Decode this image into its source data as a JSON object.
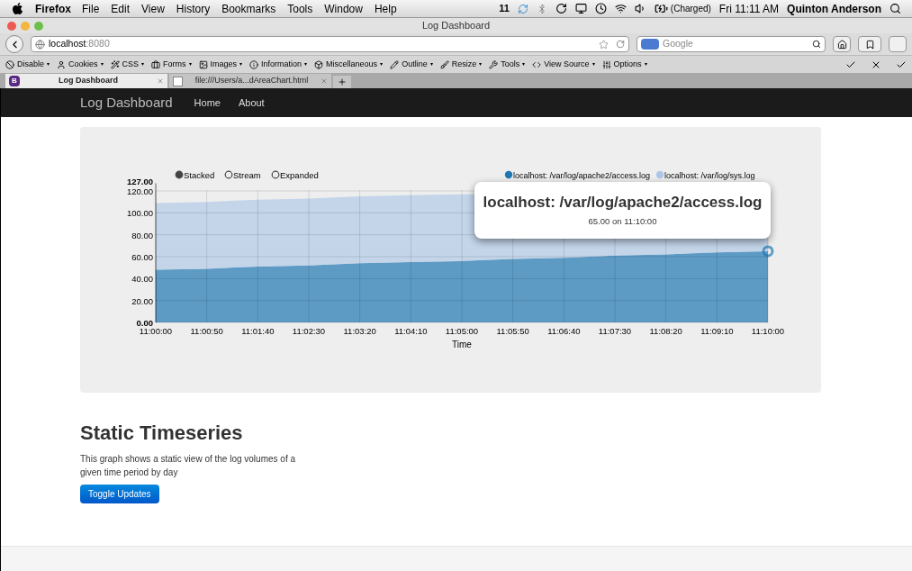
{
  "menu_bar": {
    "app": "Firefox",
    "items": [
      "File",
      "Edit",
      "View",
      "History",
      "Bookmarks",
      "Tools",
      "Window",
      "Help"
    ],
    "status": {
      "adobe_count": "11",
      "battery": "(Charged)",
      "clock": "Fri 11:11 AM",
      "user": "Quinton Anderson"
    }
  },
  "window": {
    "title": "Log Dashboard"
  },
  "address_bar": {
    "host": "localhost",
    "port": ":8080",
    "search_placeholder": "Google"
  },
  "dev_toolbar": [
    {
      "label": "Disable",
      "caret": "▾"
    },
    {
      "label": "Cookies",
      "caret": "▾"
    },
    {
      "label": "CSS",
      "caret": "▾"
    },
    {
      "label": "Forms",
      "caret": "▾"
    },
    {
      "label": "Images",
      "caret": "▾"
    },
    {
      "label": "Information",
      "caret": "▾"
    },
    {
      "label": "Miscellaneous",
      "caret": "▾"
    },
    {
      "label": "Outline",
      "caret": "▾"
    },
    {
      "label": "Resize",
      "caret": "▾"
    },
    {
      "label": "Tools",
      "caret": "▾"
    },
    {
      "label": "View Source",
      "caret": "▾"
    },
    {
      "label": "Options",
      "caret": "▾"
    }
  ],
  "tabs": [
    {
      "label": "Log Dashboard",
      "favicon": "B",
      "selected": true
    },
    {
      "label": "file:///Users/a...dAreaChart.html",
      "selected": false
    }
  ],
  "navbar": {
    "brand": "Log Dashboard",
    "links": [
      "Home",
      "About"
    ]
  },
  "chart": {
    "modes": [
      {
        "label": "Stacked",
        "selected": true
      },
      {
        "label": "Stream",
        "selected": false
      },
      {
        "label": "Expanded",
        "selected": false
      }
    ],
    "tooltip": {
      "title": "localhost: /var/log/apache2/access.log",
      "text": "65.00 on 11:10:00"
    },
    "chart_data": {
      "type": "area",
      "stacked": true,
      "grid": true,
      "legend": "top-right",
      "xlabel": "Time",
      "categories": [
        "11:00:00",
        "11:00:50",
        "11:01:40",
        "11:02:30",
        "11:03:20",
        "11:04:10",
        "11:05:00",
        "11:05:50",
        "11:06:40",
        "11:07:30",
        "11:08:20",
        "11:09:10",
        "11:10:00"
      ],
      "series": [
        {
          "name": "localhost: /var/log/apache2/access.log",
          "color": "#1f77b4",
          "values": [
            48,
            49,
            51,
            52,
            54,
            55,
            56,
            58,
            59,
            61,
            62,
            64,
            65
          ]
        },
        {
          "name": "localhost: /var/log/sys.log",
          "color": "#aec7e8",
          "values": [
            61,
            61,
            61,
            61,
            61,
            61,
            61,
            null,
            null,
            null,
            null,
            null,
            null
          ]
        }
      ],
      "yticks": [
        {
          "value": 0,
          "label": "0.00"
        },
        {
          "value": 20,
          "label": "20.00"
        },
        {
          "value": 40,
          "label": "40.00"
        },
        {
          "value": 60,
          "label": "60.00"
        },
        {
          "value": 80,
          "label": "80.00"
        },
        {
          "value": 100,
          "label": "100.00"
        },
        {
          "value": 120,
          "label": "120.00"
        },
        {
          "value": 127,
          "label": "127.00"
        }
      ],
      "ylim": [
        0,
        127
      ]
    }
  },
  "section": {
    "heading": "Static Timeseries",
    "description": "This graph shows a static view of the log volumes of a given time period by day",
    "button": "Toggle Updates"
  }
}
